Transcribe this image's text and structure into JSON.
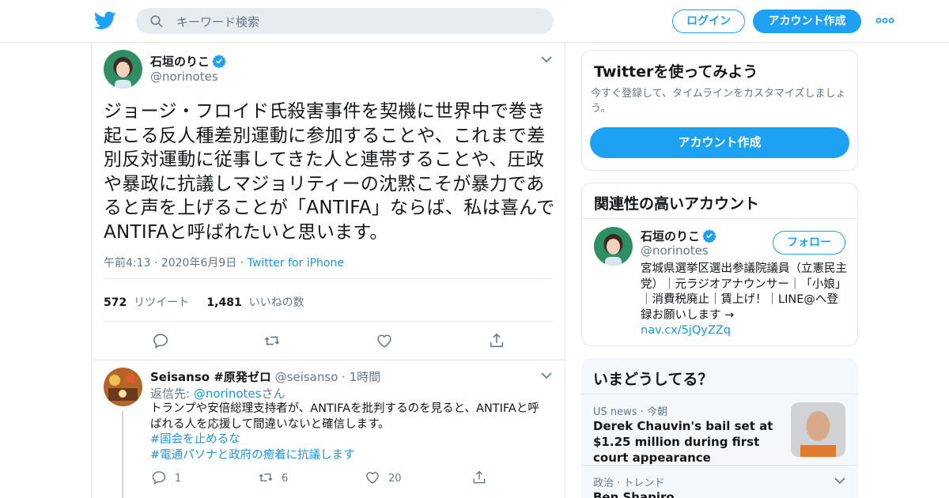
{
  "header": {
    "search_placeholder": "キーワード検索",
    "login_label": "ログイン",
    "signup_label": "アカウント作成"
  },
  "tweet": {
    "name": "石垣のりこ",
    "handle": "@norinotes",
    "text": "ジョージ・フロイド氏殺害事件を契機に世界中で巻き起こる反人種差別運動に参加することや、これまで差別反対運動に従事してきた人と連帯することや、圧政や暴政に抗議しマジョリティーの沈黙こそが暴力であると声を上げることが「ANTIFA」ならば、私は喜んでANTIFAと呼ばれたいと思います。",
    "time": "午前4:13",
    "date": "2020年6月9日",
    "source": "Twitter for iPhone",
    "retweet_count": "572",
    "retweet_label": "リツイート",
    "like_count": "1,481",
    "like_label": "いいねの数"
  },
  "reply": {
    "name": "Seisanso #原発ゼロ",
    "handle": "@seisanso",
    "time": "1時間",
    "replying_prefix": "返信先: ",
    "replying_to": "@norinotes",
    "replying_suffix": "さん",
    "text": "トランプや安倍総理支持者が、ANTIFAを批判するのを見ると、ANTIFAと呼ばれる人を応援して間違いないと確信します。",
    "hashtag1": "#国会を止めるな",
    "hashtag2": "#電通パソナと政府の癒着に抗議します",
    "reply_count": "1",
    "retweet_count": "6",
    "like_count": "20"
  },
  "sidebar": {
    "try_title": "Twitterを使ってみよう",
    "try_sub": "今すぐ登録して、タイムラインをカスタマイズしましょう。",
    "try_button": "アカウント作成",
    "related_title": "関連性の高いアカウント",
    "related_name": "石垣のりこ",
    "related_handle": "@norinotes",
    "follow_label": "フォロー",
    "related_bio": "宮城県選挙区選出参議院議員（立憲民主党）｜元ラジオアナウンサー｜「小娘」｜消費税廃止｜賃上げ！｜LINE@へ登録お願いします →",
    "related_link": "nav.cx/5jQyZZq",
    "trends_title": "いまどうしてる？",
    "trend1_category": "US news",
    "trend1_time": "今朝",
    "trend1_title": "Derek Chauvin's bail set at $1.25 million during first court appearance",
    "trend2_category": "政治 · トレンド",
    "trend2_title": "Ben Shapiro"
  },
  "colors": {
    "accent": "#1da1f2",
    "link": "#1b95e0",
    "muted": "#657786",
    "border": "#e1e8ed"
  }
}
